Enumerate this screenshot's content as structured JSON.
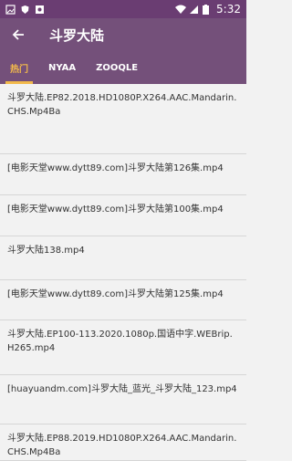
{
  "status": {
    "time": "5:32"
  },
  "appbar": {
    "title": "斗罗大陆"
  },
  "tabs": [
    "热门",
    "NYAA",
    "ZOOQLE"
  ],
  "items": [
    "斗罗大陆.EP82.2018.HD1080P.X264.AAC.Mandarin.CHS.Mp4Ba",
    "[电影天堂www.dytt89.com]斗罗大陆第126集.mp4",
    "[电影天堂www.dytt89.com]斗罗大陆第100集.mp4",
    "斗罗大陆138.mp4",
    "[电影天堂www.dytt89.com]斗罗大陆第125集.mp4",
    "斗罗大陆.EP100-113.2020.1080p.国语中字.WEBrip.H265.mp4",
    "[huayuandm.com]斗罗大陆_蓝光_斗罗大陆_123.mp4",
    "斗罗大陆.EP88.2019.HD1080P.X264.AAC.Mandarin.CHS.Mp4Ba"
  ]
}
